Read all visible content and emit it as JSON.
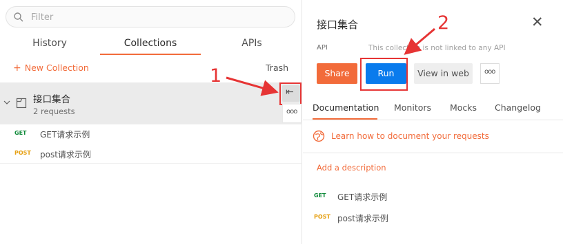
{
  "left_panel": {
    "search": {
      "placeholder": "Filter"
    },
    "tabs": [
      {
        "label": "History"
      },
      {
        "label": "Collections"
      },
      {
        "label": "APIs"
      }
    ],
    "new_collection_label": "New Collection",
    "trash_label": "Trash",
    "collection": {
      "name": "接口集合",
      "subtitle": "2 requests",
      "collapse_glyph": "⇤",
      "more_glyph": "ooo"
    },
    "requests": [
      {
        "method": "GET",
        "name": "GET请求示例"
      },
      {
        "method": "POST",
        "name": "post请求示例"
      }
    ]
  },
  "right_panel": {
    "title": "接口集合",
    "close_glyph": "✕",
    "api_label": "API",
    "api_info": "This collection is not linked to any API",
    "buttons": {
      "share": "Share",
      "run": "Run",
      "view_in_web": "View in web",
      "more": "ooo"
    },
    "tabs": [
      {
        "label": "Documentation"
      },
      {
        "label": "Monitors"
      },
      {
        "label": "Mocks"
      },
      {
        "label": "Changelog"
      }
    ],
    "learn_link": "Learn how to document your requests",
    "add_description": "Add a description",
    "requests": [
      {
        "method": "GET",
        "name": "GET请求示例"
      },
      {
        "method": "POST",
        "name": "post请求示例"
      }
    ]
  },
  "annotations": {
    "label_1": "1",
    "label_2": "2"
  },
  "colors": {
    "accent_orange": "#f26b3a",
    "run_blue": "#097bed",
    "annotation_red": "#e63434",
    "get_green": "#0f8a3a",
    "post_amber": "#e6a013"
  }
}
